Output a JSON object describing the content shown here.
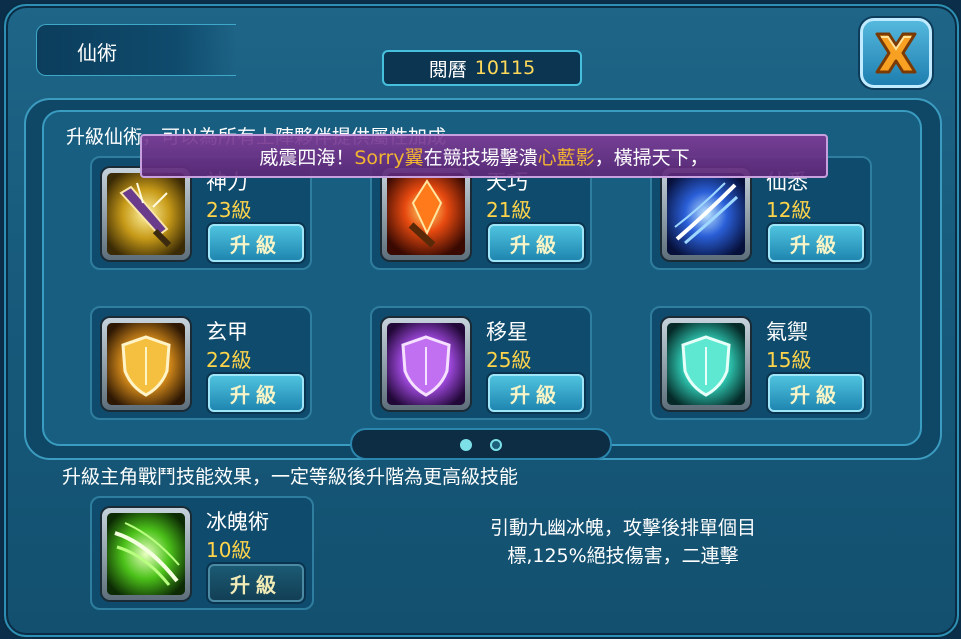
{
  "header": {
    "title": "仙術",
    "exp_label": "閱曆",
    "exp_value": "10115"
  },
  "announcement": {
    "prefix": "威震四海！",
    "player": "Sorry翼",
    "middle": "在競技場擊潰",
    "target": "心藍影",
    "suffix": "，橫掃天下，"
  },
  "skill_section": {
    "description": "升級仙術，可以為所有上陣夥伴提供屬性加成",
    "skills": [
      {
        "name": "神力",
        "level": "23級",
        "button": "升級",
        "icon": "sword-icon"
      },
      {
        "name": "天巧",
        "level": "21級",
        "button": "升級",
        "icon": "fire-blade-icon"
      },
      {
        "name": "仙悉",
        "level": "12級",
        "button": "升級",
        "icon": "blue-slash-icon"
      },
      {
        "name": "玄甲",
        "level": "22級",
        "button": "升級",
        "icon": "gold-shield-icon"
      },
      {
        "name": "移星",
        "level": "25級",
        "button": "升級",
        "icon": "purple-shield-icon"
      },
      {
        "name": "氣禦",
        "level": "15級",
        "button": "升級",
        "icon": "cyan-shield-icon"
      }
    ],
    "pager": {
      "pages": 2,
      "current": 1
    }
  },
  "main_skill": {
    "description": "升級主角戰鬥技能效果，一定等級後升階為更高級技能",
    "name": "冰魄術",
    "level": "10級",
    "button": "升級",
    "icon": "green-slash-icon",
    "effect_line1": "引動九幽冰魄，攻擊後排單個目",
    "effect_line2": "標,125%絕技傷害，二連擊"
  },
  "colors": {
    "level_text": "#ffd44a",
    "exp_value": "#ffd95a",
    "announcement_highlight": "#f2b530"
  }
}
